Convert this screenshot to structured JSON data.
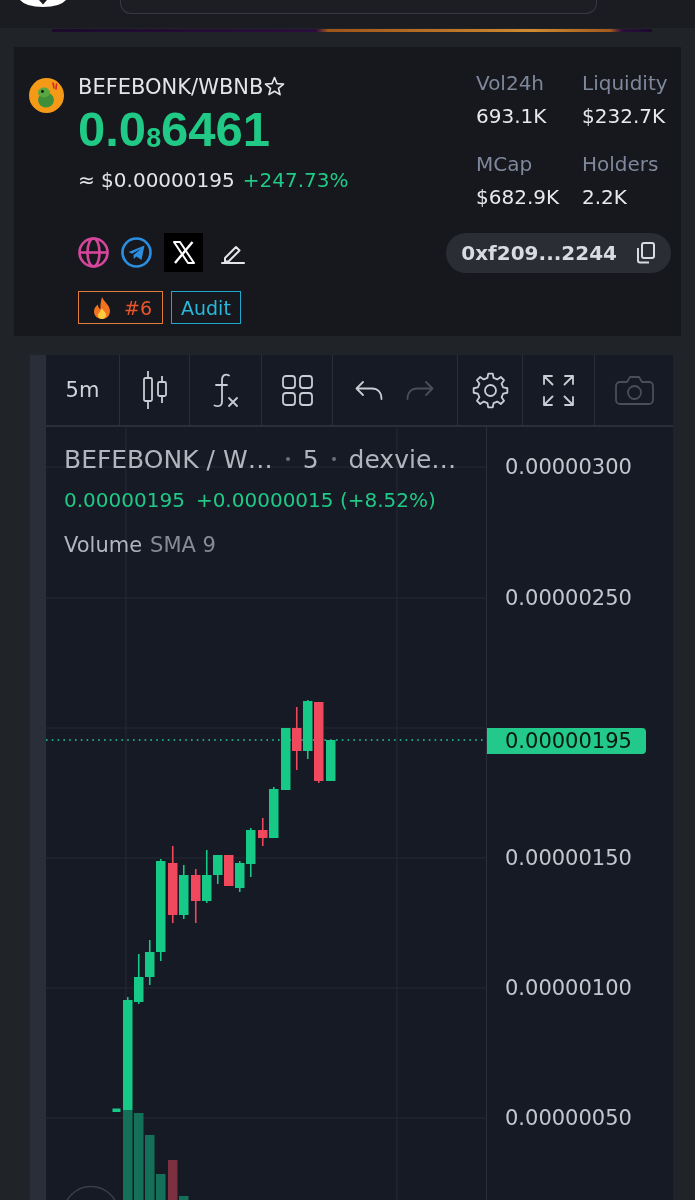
{
  "token": {
    "pair": "BEFEBONK/WBNB",
    "favorite": false,
    "price": "0.0$_{8}$6461",
    "price_usd": "≈ $0.00000195",
    "change": "+247.73%"
  },
  "stats": [
    {
      "label": "Vol24h",
      "value": "693.1K"
    },
    {
      "label": "Liquidity",
      "value": "$232.7K"
    },
    {
      "label": "MCap",
      "value": "$682.9K"
    },
    {
      "label": "Holders",
      "value": "2.2K"
    }
  ],
  "links": [
    {
      "kind": "website"
    },
    {
      "kind": "telegram"
    },
    {
      "kind": "x"
    },
    {
      "kind": "edit"
    }
  ],
  "address": "0xf209...2244",
  "tags": [
    {
      "kind": "trending",
      "label": "#6"
    },
    {
      "kind": "audit",
      "label": "Audit"
    }
  ],
  "toolbar": [
    {
      "items": [
        {
          "kind": "interval",
          "label": "5m",
          "disabled": false
        }
      ]
    },
    {
      "items": [
        {
          "kind": "chart_type",
          "disabled": false
        }
      ]
    },
    {
      "items": [
        {
          "kind": "indicators",
          "disabled": false
        }
      ]
    },
    {
      "items": [
        {
          "kind": "templates",
          "disabled": false
        }
      ]
    },
    {
      "items": [
        {
          "kind": "undo",
          "disabled": false
        },
        {
          "kind": "redo",
          "disabled": true
        }
      ]
    },
    {
      "items": [
        {
          "kind": "settings",
          "disabled": false
        }
      ]
    },
    {
      "items": [
        {
          "kind": "fullscreen",
          "disabled": false
        }
      ]
    },
    {
      "items": [
        {
          "kind": "screenshot",
          "disabled": true
        }
      ]
    }
  ],
  "chart": {
    "legend": {
      "symbol": "BEFEBONK / W…",
      "interval": "5",
      "source": "dexvie…",
      "price": "0.00000195",
      "change": "+0.00000015 (+8.52%)",
      "indicator": "Volume",
      "indicator_args": "SMA 9"
    },
    "price_axis": [
      "0.00000300",
      "0.00000250",
      "0.00000150",
      "0.00000100",
      "0.00000050"
    ],
    "last_price": "0.00000195"
  }
}
